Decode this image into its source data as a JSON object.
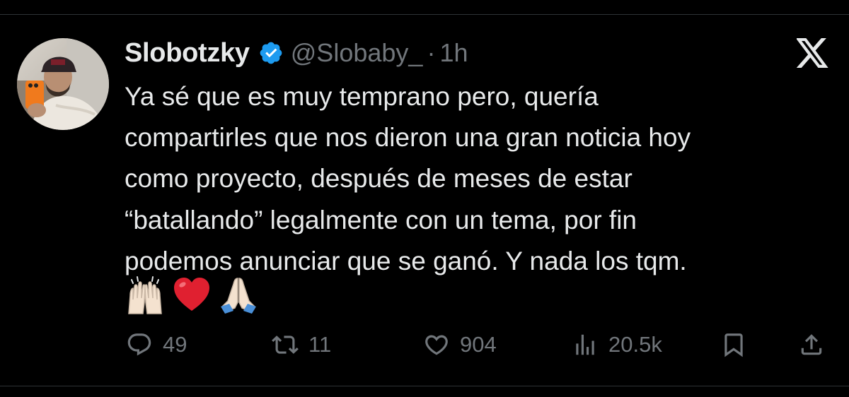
{
  "tweet": {
    "display_name": "Slobotzky",
    "verified": true,
    "handle": "@Slobaby_",
    "separator": "·",
    "time": "1h",
    "text_lines": [
      "Ya sé que es muy temprano pero, quería",
      "compartirles que nos dieron una gran noticia hoy",
      "como proyecto, después de meses de estar",
      "“batallando” legalmente con un tema, por fin",
      "podemos anunciar que se ganó. Y nada los tqm."
    ],
    "emojis": [
      "raising-hands-icon",
      "red-heart-icon",
      "folded-hands-icon"
    ]
  },
  "actions": {
    "replies": "49",
    "reposts": "11",
    "likes": "904",
    "views": "20.5k"
  },
  "brand": {
    "logo": "x-logo-icon"
  },
  "colors": {
    "background": "#000000",
    "text_primary": "#e7e9ea",
    "text_secondary": "#71767b",
    "verified_blue": "#1d9bf0",
    "divider": "#2f3336"
  }
}
